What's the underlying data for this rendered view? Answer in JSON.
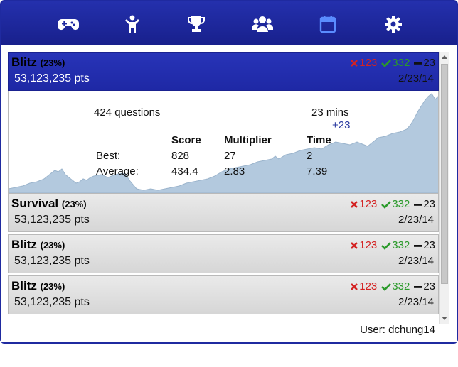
{
  "toolbar": {
    "icons": [
      {
        "name": "gamepad-icon"
      },
      {
        "name": "person-icon"
      },
      {
        "name": "trophy-icon"
      },
      {
        "name": "group-icon"
      },
      {
        "name": "calendar-icon",
        "active": true
      },
      {
        "name": "gear-icon"
      }
    ],
    "icon_color": "#ffffff",
    "active_icon_color": "#5a8cff"
  },
  "rows": [
    {
      "mode": "Blitz",
      "pct": "(23%)",
      "pts": "53,123,235 pts",
      "wrong": "123",
      "right": "332",
      "tie": "23",
      "date": "2/23/14",
      "active": true
    },
    {
      "mode": "Survival",
      "pct": "(23%)",
      "pts": "53,123,235 pts",
      "wrong": "123",
      "right": "332",
      "tie": "23",
      "date": "2/23/14"
    },
    {
      "mode": "Blitz",
      "pct": "(23%)",
      "pts": "53,123,235 pts",
      "wrong": "123",
      "right": "332",
      "tie": "23",
      "date": "2/23/14"
    },
    {
      "mode": "Blitz",
      "pct": "(23%)",
      "pts": "53,123,235 pts",
      "wrong": "123",
      "right": "332",
      "tie": "23",
      "date": "2/23/14"
    }
  ],
  "detail": {
    "questions": "424 questions",
    "mins": "23 mins",
    "delta": "+23",
    "headers": [
      "Score",
      "Multiplier",
      "Time"
    ],
    "best_label": "Best:",
    "best": [
      "828",
      "27",
      "2"
    ],
    "avg_label": "Average:",
    "avg": [
      "434.4",
      "2.83",
      "7.39"
    ]
  },
  "footer": {
    "user": "User: dchung14"
  },
  "colors": {
    "frame": "#1f2aa0",
    "active_row": "#2430b0",
    "wrong": "#d42222",
    "right": "#2a9a2a",
    "graph_fill": "#b3c9de"
  }
}
